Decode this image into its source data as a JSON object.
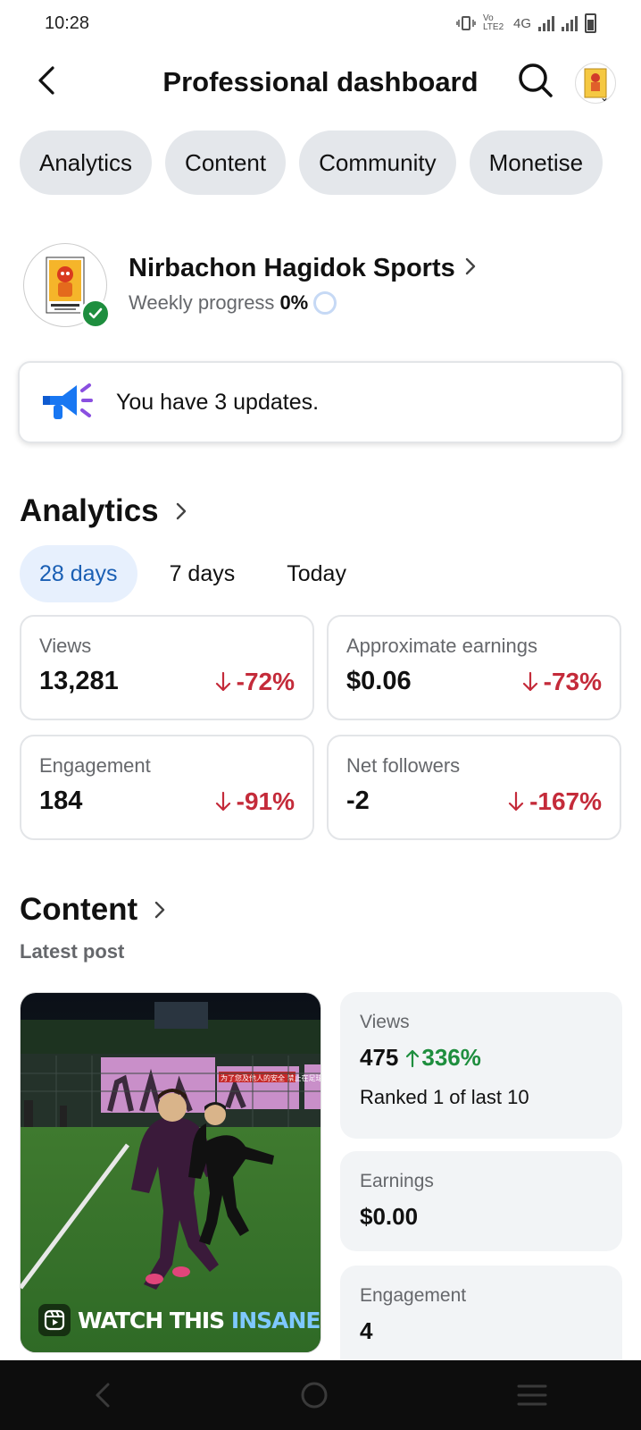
{
  "status_bar": {
    "time": "10:28",
    "network": "4G",
    "volte": "Vo LTE2"
  },
  "header": {
    "title": "Professional dashboard"
  },
  "tabs": [
    {
      "label": "Analytics"
    },
    {
      "label": "Content"
    },
    {
      "label": "Community"
    },
    {
      "label": "Monetise"
    }
  ],
  "profile": {
    "name": "Nirbachon Hagidok Sports",
    "progress_label": "Weekly progress",
    "progress_value": "0%",
    "progress_fraction": 0
  },
  "updates": {
    "text": "You have 3 updates."
  },
  "analytics": {
    "title": "Analytics",
    "ranges": [
      {
        "label": "28 days",
        "active": true
      },
      {
        "label": "7 days",
        "active": false
      },
      {
        "label": "Today",
        "active": false
      }
    ],
    "metrics": [
      {
        "label": "Views",
        "value": "13,281",
        "change": "-72%"
      },
      {
        "label": "Approximate earnings",
        "value": "$0.06",
        "change": "-73%"
      },
      {
        "label": "Engagement",
        "value": "184",
        "change": "-91%"
      },
      {
        "label": "Net followers",
        "value": "-2",
        "change": "-167%"
      }
    ]
  },
  "content": {
    "title": "Content",
    "latest_label": "Latest post",
    "post": {
      "caption_main": "WATCH THIS",
      "caption_highlight": "INSANE",
      "banner_text": "为了您及他人的安全 禁止在足球场内踢球"
    },
    "stats": {
      "views_label": "Views",
      "views_value": "475",
      "views_change": "336%",
      "views_rank": "Ranked 1 of last 10",
      "earnings_label": "Earnings",
      "earnings_value": "$0.00",
      "engagement_label": "Engagement",
      "engagement_value": "4"
    }
  },
  "colors": {
    "negative": "#c42b3a",
    "positive": "#1e8e3e",
    "accent": "#1a5fb4",
    "chip_bg": "#e4e7eb"
  }
}
